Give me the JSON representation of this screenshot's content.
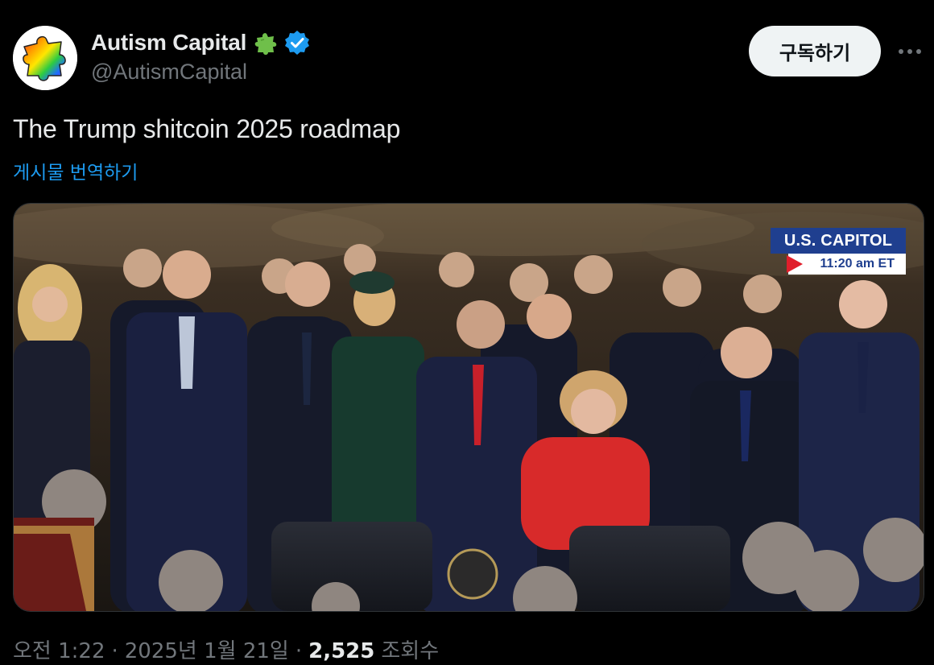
{
  "author": {
    "display_name": "Autism Capital",
    "handle": "@AutismCapital",
    "avatar": "rainbow-puzzle-piece-icon",
    "name_badges": [
      "puzzle-piece-icon",
      "verified-badge-icon"
    ]
  },
  "actions": {
    "subscribe_label": "구독하기",
    "more_icon": "more-icon"
  },
  "tweet": {
    "text": "The Trump shitcoin 2025 roadmap",
    "translate_label": "게시물 번역하기"
  },
  "media": {
    "overlay_location": "U.S. CAPITOL",
    "overlay_time": "11:20 am ET"
  },
  "meta": {
    "time": "오전 1:22",
    "date": "2025년 1월 21일",
    "separator": "·",
    "views_count": "2,525",
    "views_label": "조회수"
  },
  "colors": {
    "background": "#000000",
    "text_primary": "#e7e9ea",
    "text_secondary": "#71767b",
    "link": "#1d9bf0",
    "verified": "#1d9bf0",
    "badge_green": "#6fbf4a",
    "button_bg": "#eff3f4",
    "news_blue": "#1f3f8f",
    "news_red": "#e01e2b"
  }
}
